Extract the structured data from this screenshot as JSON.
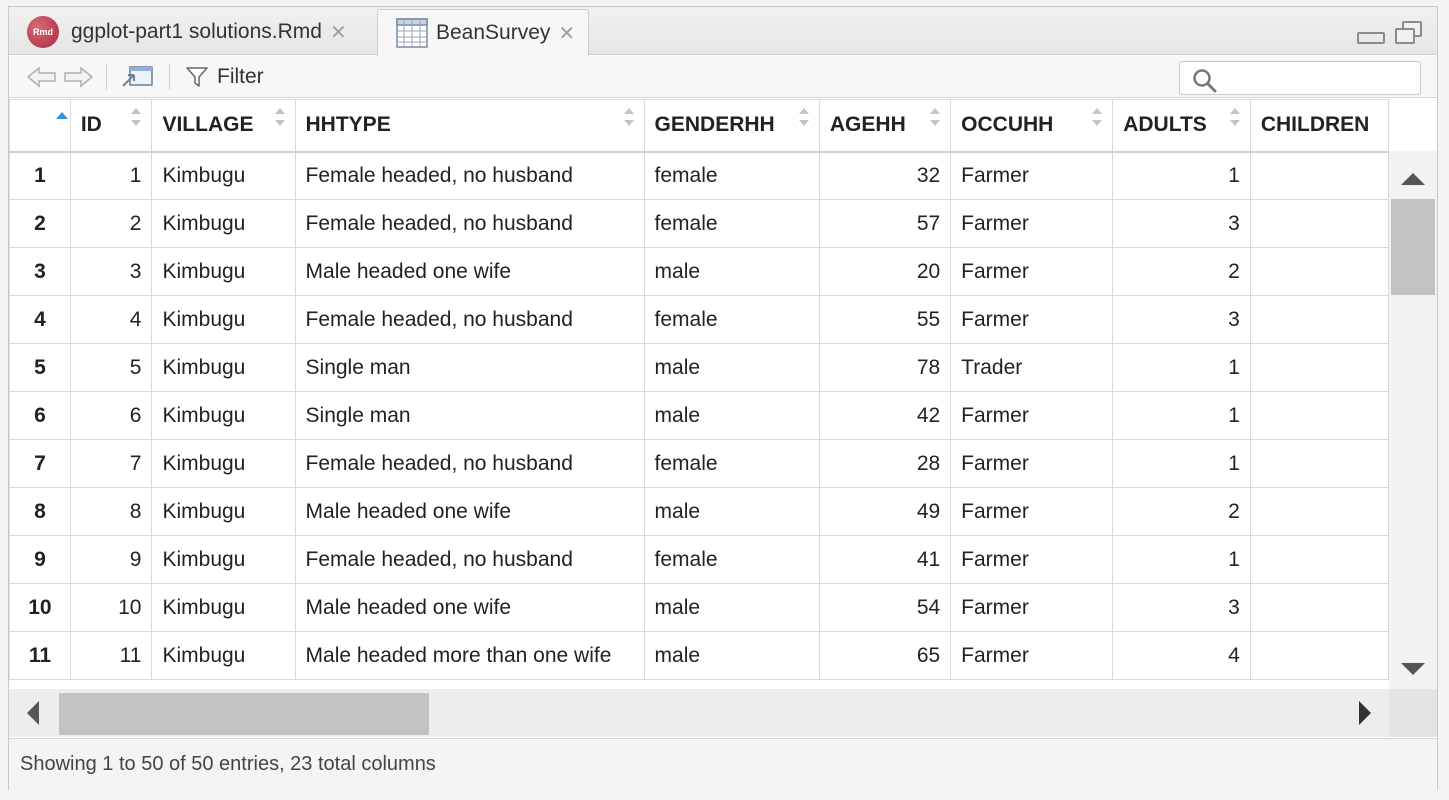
{
  "tabs": [
    {
      "label": "ggplot-part1 solutions.Rmd",
      "icon": "rmd-file-icon",
      "icon_text": "Rmd",
      "active": false
    },
    {
      "label": "BeanSurvey",
      "icon": "data-grid-icon",
      "active": true
    }
  ],
  "tab_close_glyph": "✕",
  "toolbar": {
    "filter_label": "Filter",
    "search_value": ""
  },
  "table": {
    "columns": [
      "ID",
      "VILLAGE",
      "HHTYPE",
      "GENDERHH",
      "AGEHH",
      "OCCUHH",
      "ADULTS",
      "CHILDREN"
    ],
    "sort_column": "row-number",
    "sort_direction": "ascending",
    "rows": [
      {
        "n": "1",
        "ID": "1",
        "VILLAGE": "Kimbugu",
        "HHTYPE": "Female headed, no husband",
        "GENDERHH": "female",
        "AGEHH": "32",
        "OCCUHH": "Farmer",
        "ADULTS": "1"
      },
      {
        "n": "2",
        "ID": "2",
        "VILLAGE": "Kimbugu",
        "HHTYPE": "Female headed, no husband",
        "GENDERHH": "female",
        "AGEHH": "57",
        "OCCUHH": "Farmer",
        "ADULTS": "3"
      },
      {
        "n": "3",
        "ID": "3",
        "VILLAGE": "Kimbugu",
        "HHTYPE": "Male headed one wife",
        "GENDERHH": "male",
        "AGEHH": "20",
        "OCCUHH": "Farmer",
        "ADULTS": "2"
      },
      {
        "n": "4",
        "ID": "4",
        "VILLAGE": "Kimbugu",
        "HHTYPE": "Female headed, no husband",
        "GENDERHH": "female",
        "AGEHH": "55",
        "OCCUHH": "Farmer",
        "ADULTS": "3"
      },
      {
        "n": "5",
        "ID": "5",
        "VILLAGE": "Kimbugu",
        "HHTYPE": "Single man",
        "GENDERHH": "male",
        "AGEHH": "78",
        "OCCUHH": "Trader",
        "ADULTS": "1"
      },
      {
        "n": "6",
        "ID": "6",
        "VILLAGE": "Kimbugu",
        "HHTYPE": "Single man",
        "GENDERHH": "male",
        "AGEHH": "42",
        "OCCUHH": "Farmer",
        "ADULTS": "1"
      },
      {
        "n": "7",
        "ID": "7",
        "VILLAGE": "Kimbugu",
        "HHTYPE": "Female headed, no husband",
        "GENDERHH": "female",
        "AGEHH": "28",
        "OCCUHH": "Farmer",
        "ADULTS": "1"
      },
      {
        "n": "8",
        "ID": "8",
        "VILLAGE": "Kimbugu",
        "HHTYPE": "Male headed one wife",
        "GENDERHH": "male",
        "AGEHH": "49",
        "OCCUHH": "Farmer",
        "ADULTS": "2"
      },
      {
        "n": "9",
        "ID": "9",
        "VILLAGE": "Kimbugu",
        "HHTYPE": "Female headed, no husband",
        "GENDERHH": "female",
        "AGEHH": "41",
        "OCCUHH": "Farmer",
        "ADULTS": "1"
      },
      {
        "n": "10",
        "ID": "10",
        "VILLAGE": "Kimbugu",
        "HHTYPE": "Male headed one wife",
        "GENDERHH": "male",
        "AGEHH": "54",
        "OCCUHH": "Farmer",
        "ADULTS": "3"
      },
      {
        "n": "11",
        "ID": "11",
        "VILLAGE": "Kimbugu",
        "HHTYPE": "Male headed more than one wife",
        "GENDERHH": "male",
        "AGEHH": "65",
        "OCCUHH": "Farmer",
        "ADULTS": "4"
      }
    ]
  },
  "status": {
    "text": "Showing 1 to 50 of 50 entries, 23 total columns"
  },
  "colors": {
    "sort_indicator": "#3d8de0",
    "border": "#d9d9d9",
    "scroll_thumb": "#c2c2c2"
  }
}
